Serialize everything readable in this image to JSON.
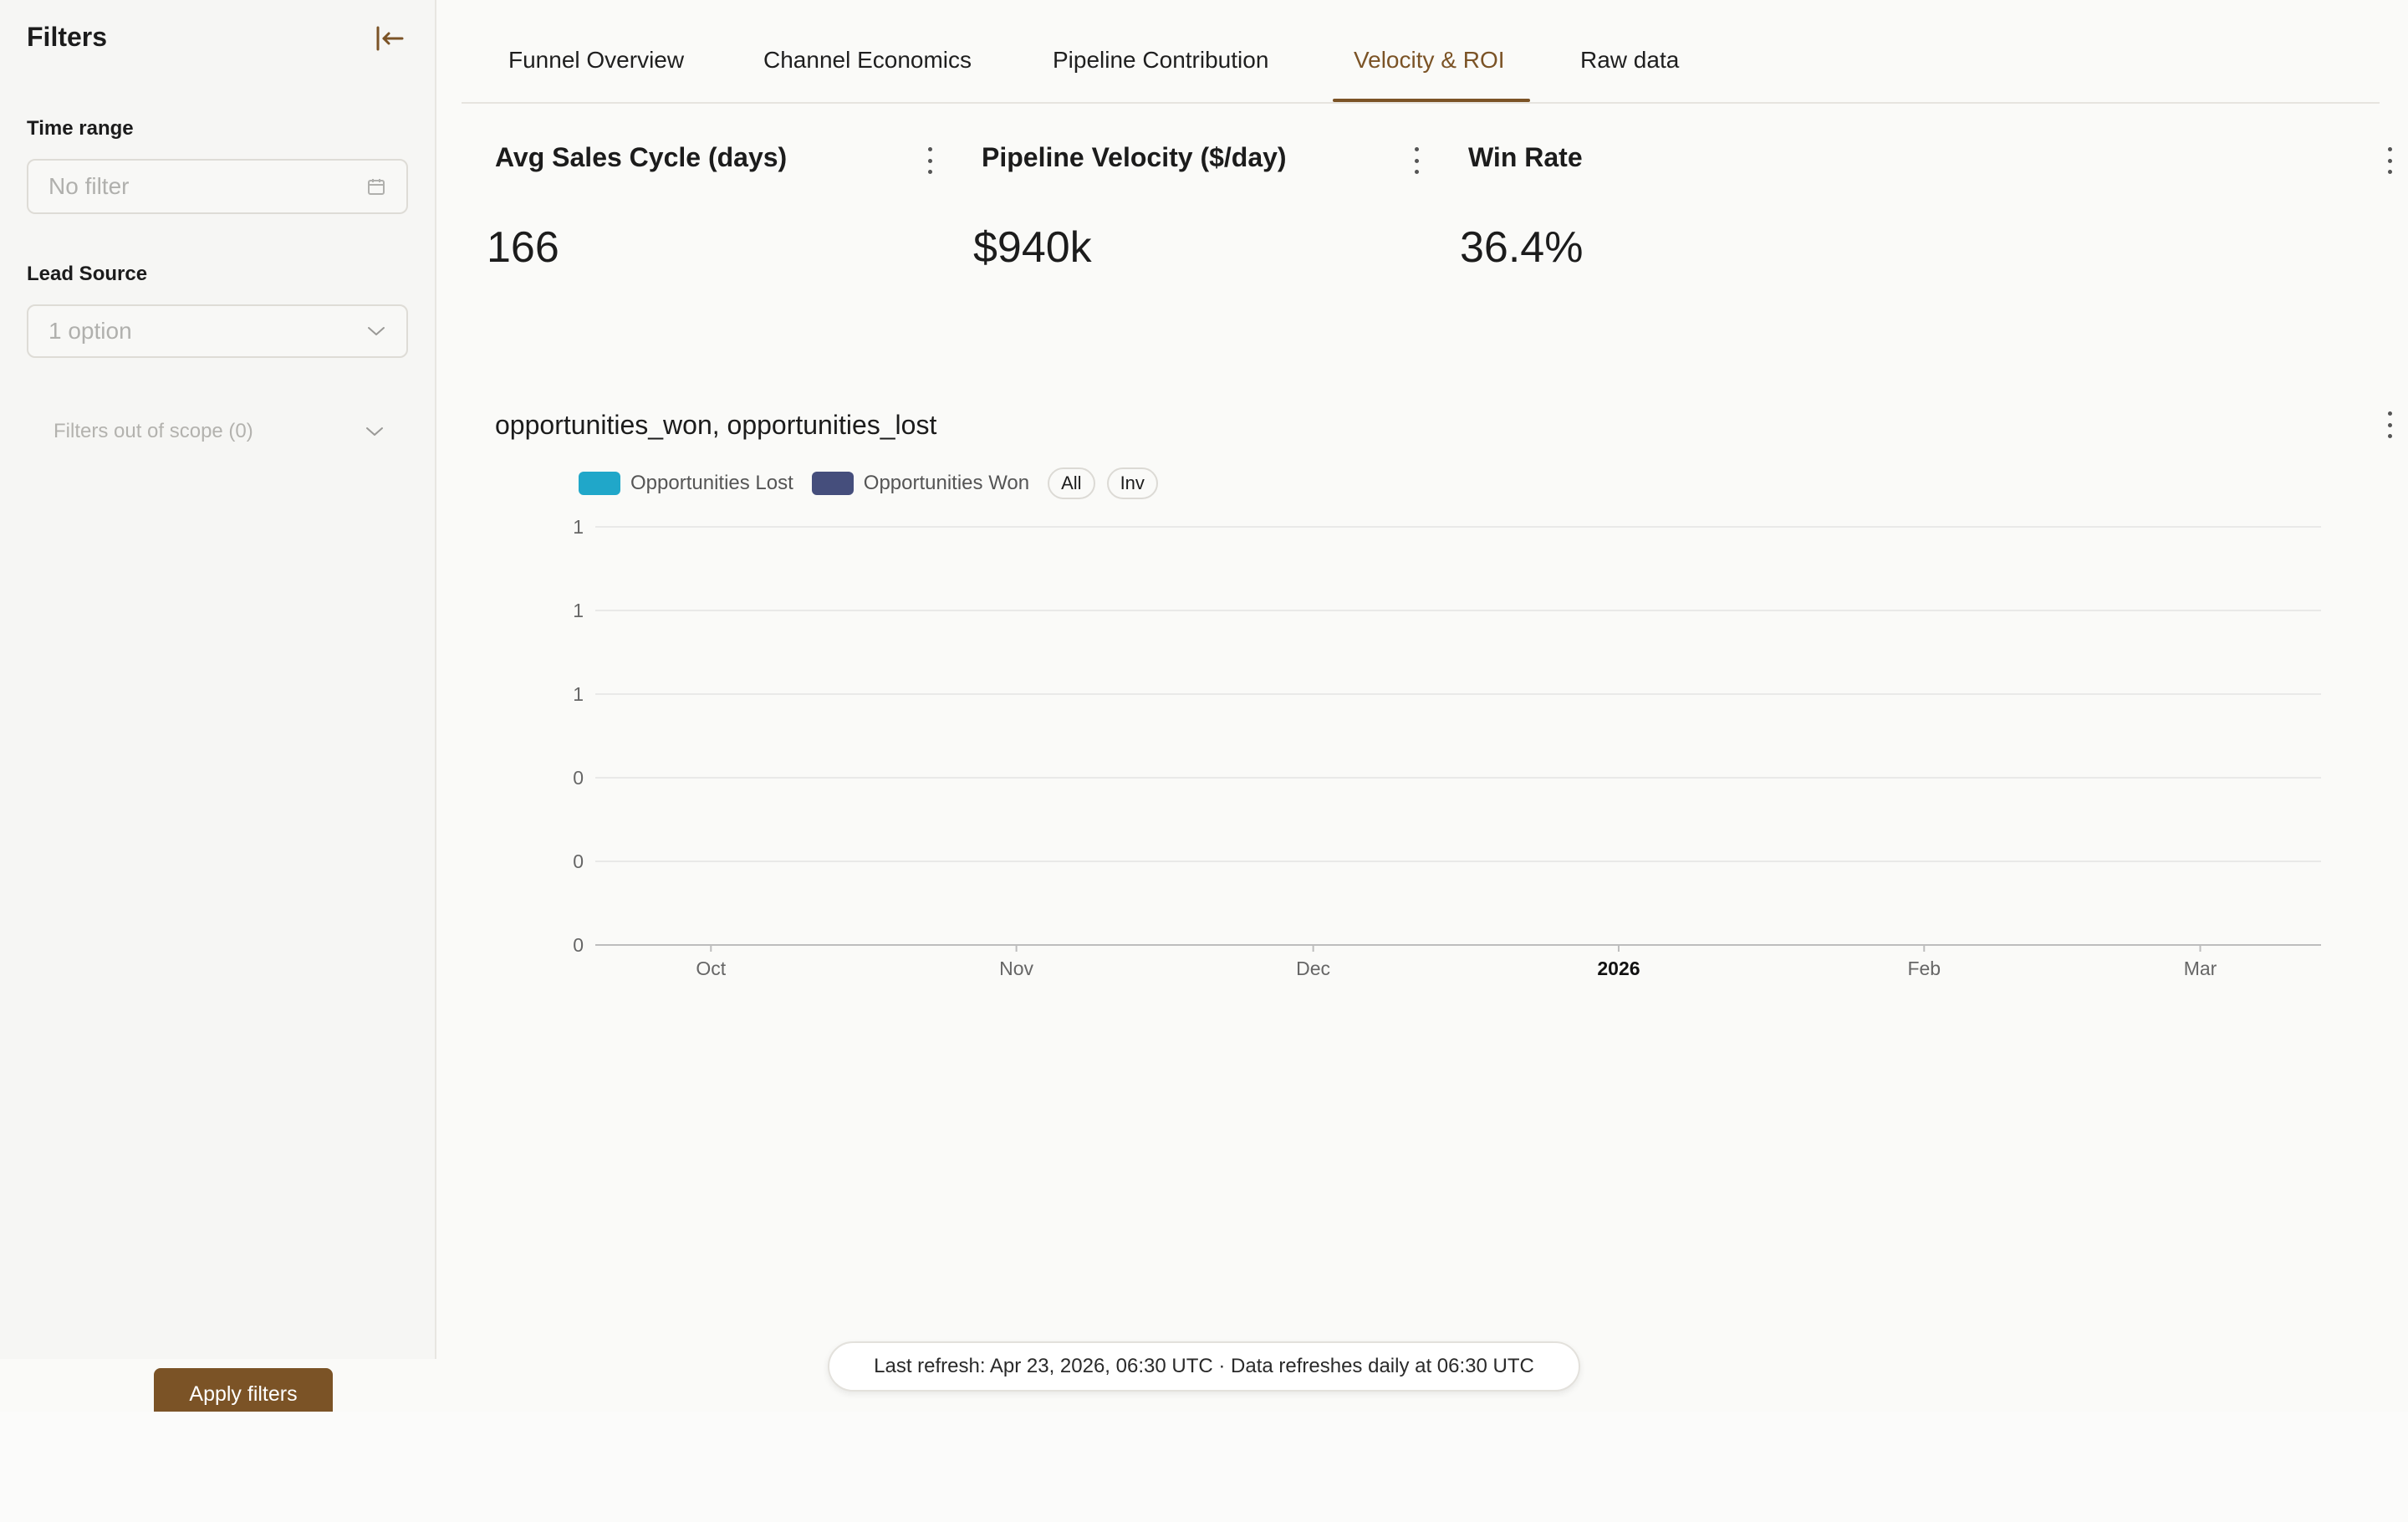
{
  "sidebar": {
    "title": "Filters",
    "time_range": {
      "label": "Time range",
      "placeholder": "No filter"
    },
    "lead_source": {
      "label": "Lead Source",
      "placeholder": "1 option"
    },
    "out_of_scope": "Filters out of scope (0)",
    "apply_label": "Apply filters"
  },
  "tabs": [
    {
      "label": "Funnel Overview",
      "active": false
    },
    {
      "label": "Channel Economics",
      "active": false
    },
    {
      "label": "Pipeline Contribution",
      "active": false
    },
    {
      "label": "Velocity & ROI",
      "active": true
    },
    {
      "label": "Raw data",
      "active": false
    }
  ],
  "kpis": [
    {
      "title": "Avg Sales Cycle (days)",
      "value": "166"
    },
    {
      "title": "Pipeline Velocity ($/day)",
      "value": "$940k"
    },
    {
      "title": "Win Rate",
      "value": "36.4%"
    }
  ],
  "chart": {
    "title": "opportunities_won, opportunities_lost",
    "legend_controls": {
      "all": "All",
      "inv": "Inv"
    }
  },
  "chart_data": {
    "type": "bar",
    "title": "opportunities_won, opportunities_lost",
    "xlabel": "",
    "ylabel": "",
    "x_ticks": [
      "Oct",
      "Nov",
      "Dec",
      "2026",
      "Feb",
      "Mar"
    ],
    "y_ticks": [
      "1",
      "1",
      "1",
      "0",
      "0",
      "0"
    ],
    "series": [
      {
        "name": "Opportunities Lost",
        "color": "#20a7c9",
        "values": []
      },
      {
        "name": "Opportunities Won",
        "color": "#454e7c",
        "values": []
      }
    ],
    "grid": true,
    "legend": "top-left"
  },
  "colors": {
    "accent": "#7b5326",
    "background": "#fafaf8"
  },
  "refresh_text": "Last refresh: Apr 23, 2026, 06:30 UTC · Data refreshes daily at 06:30 UTC"
}
